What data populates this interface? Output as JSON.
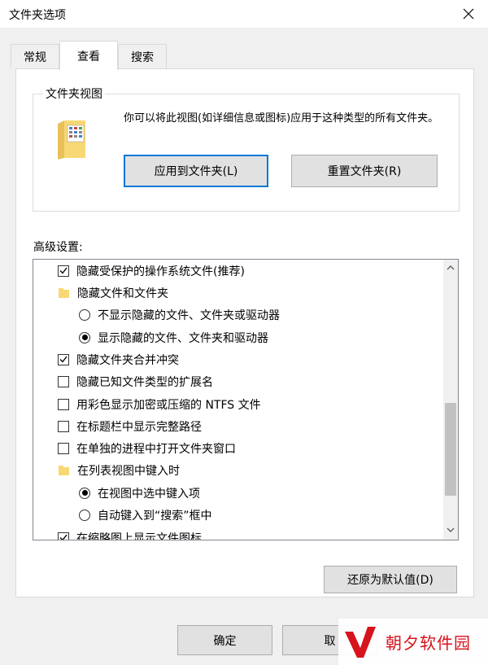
{
  "window": {
    "title": "文件夹选项"
  },
  "tabs": [
    {
      "label": "常规"
    },
    {
      "label": "查看"
    },
    {
      "label": "搜索"
    }
  ],
  "folder_views": {
    "title": "文件夹视图",
    "description": "你可以将此视图(如详细信息或图标)应用于这种类型的所有文件夹。",
    "apply_button": "应用到文件夹(L)",
    "reset_button": "重置文件夹(R)"
  },
  "advanced": {
    "label": "高级设置:",
    "items": [
      {
        "type": "checkbox",
        "checked": true,
        "label": "隐藏受保护的操作系统文件(推荐)"
      },
      {
        "type": "folder",
        "label": "隐藏文件和文件夹"
      },
      {
        "type": "radio",
        "selected": false,
        "label": "不显示隐藏的文件、文件夹或驱动器"
      },
      {
        "type": "radio",
        "selected": true,
        "label": "显示隐藏的文件、文件夹和驱动器"
      },
      {
        "type": "checkbox",
        "checked": true,
        "label": "隐藏文件夹合并冲突"
      },
      {
        "type": "checkbox",
        "checked": false,
        "label": "隐藏已知文件类型的扩展名"
      },
      {
        "type": "checkbox",
        "checked": false,
        "label": "用彩色显示加密或压缩的 NTFS 文件"
      },
      {
        "type": "checkbox",
        "checked": false,
        "label": "在标题栏中显示完整路径"
      },
      {
        "type": "checkbox",
        "checked": false,
        "label": "在单独的进程中打开文件夹窗口"
      },
      {
        "type": "folder",
        "label": "在列表视图中键入时"
      },
      {
        "type": "radio",
        "selected": true,
        "label": "在视图中选中键入项"
      },
      {
        "type": "radio",
        "selected": false,
        "label": "自动键入到“搜索”框中"
      },
      {
        "type": "checkbox",
        "checked": true,
        "label": "在缩略图上显示文件图标"
      }
    ],
    "restore_defaults": "还原为默认值(D)"
  },
  "footer": {
    "ok": "确定",
    "cancel": "取"
  },
  "watermark": {
    "text": "朝夕软件园"
  },
  "colors": {
    "accent": "#0078d7",
    "folder": "#f8d775",
    "watermark_red": "#d7131d"
  }
}
